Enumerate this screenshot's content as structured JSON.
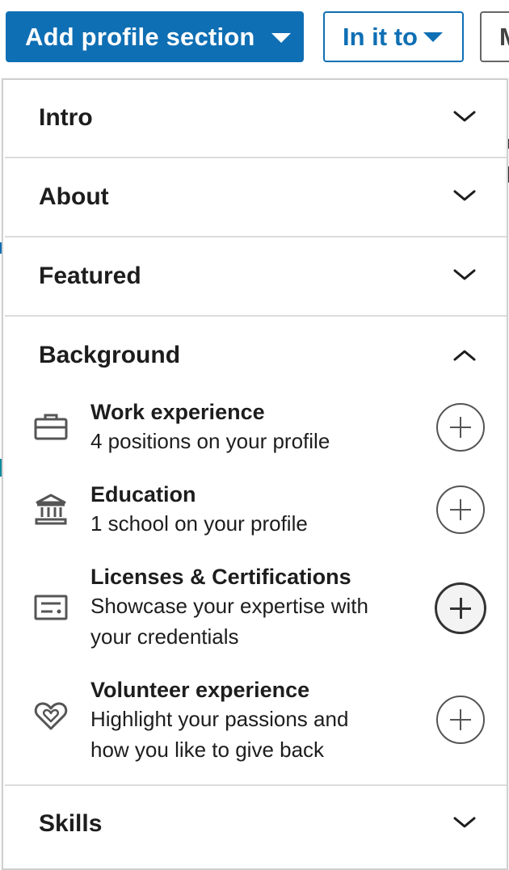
{
  "toolbar": {
    "add_section_label": "Add profile section",
    "open_to_label": "In it to",
    "more_label": "M"
  },
  "colors": {
    "brand_blue": "#0f6fb4",
    "text": "#1d1d1d",
    "divider": "#dcdcdc"
  },
  "dropdown": {
    "sections": {
      "intro": {
        "label": "Intro",
        "state": "collapsed"
      },
      "about": {
        "label": "About",
        "state": "collapsed"
      },
      "featured": {
        "label": "Featured",
        "state": "collapsed"
      },
      "background": {
        "label": "Background",
        "state": "expanded"
      },
      "skills": {
        "label": "Skills",
        "state": "collapsed"
      }
    },
    "background_items": [
      {
        "name": "Work experience",
        "desc1": "4 positions on your profile",
        "desc2": "",
        "icon": "briefcase-icon"
      },
      {
        "name": "Education",
        "desc1": "1 school on your profile",
        "desc2": "",
        "icon": "school-icon"
      },
      {
        "name": "Licenses & Certifications",
        "desc1": "Showcase your expertise with",
        "desc2": "your credentials",
        "icon": "certificate-icon"
      },
      {
        "name": "Volunteer experience",
        "desc1": "Highlight your passions and",
        "desc2": "how you like to give back",
        "icon": "heart-icon"
      }
    ]
  }
}
